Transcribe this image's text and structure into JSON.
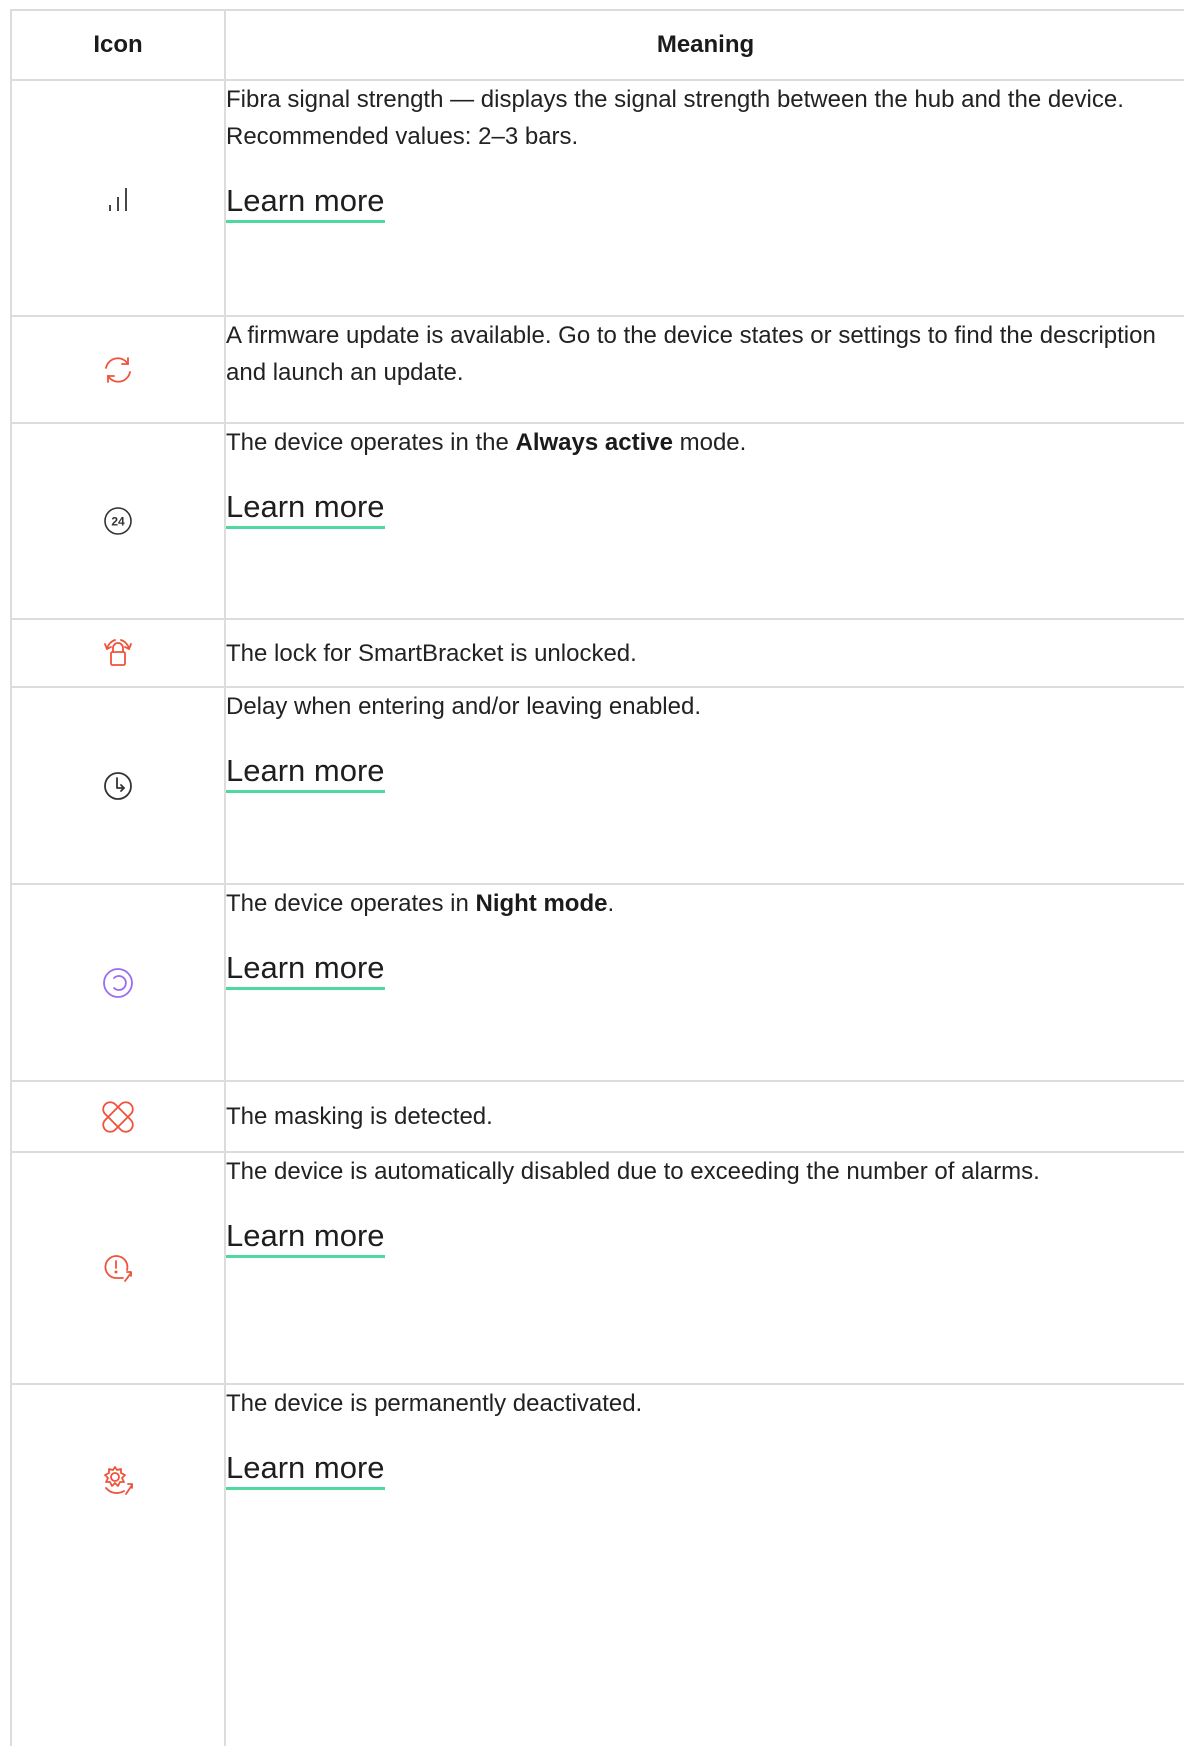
{
  "table": {
    "headers": {
      "icon": "Icon",
      "meaning": "Meaning"
    },
    "rows": [
      {
        "icon": "signal-strength-icon",
        "icon_color": "#333333",
        "text": "Fibra signal strength — displays the signal strength between the hub and the device. Recommended values: 2–3 bars.",
        "learn_more": "Learn more"
      },
      {
        "icon": "firmware-update-icon",
        "icon_color": "#f0523c",
        "text": "A firmware update is available. Go to the device states or settings to find the description and launch an update."
      },
      {
        "icon": "always-active-24-icon",
        "icon_color": "#333333",
        "text_before": "The device operates in the ",
        "text_bold": "Always active",
        "text_after": " mode.",
        "learn_more": "Learn more"
      },
      {
        "icon": "unlocked-lock-icon",
        "icon_color": "#f0523c",
        "text": "The lock for SmartBracket is unlocked."
      },
      {
        "icon": "delay-clock-icon",
        "icon_color": "#333333",
        "text": "Delay when entering and/or leaving enabled.",
        "learn_more": "Learn more"
      },
      {
        "icon": "night-mode-icon",
        "icon_color": "#9b6cf0",
        "text_before": "The device operates in ",
        "text_bold": "Night mode",
        "text_after": ".",
        "learn_more": "Learn more"
      },
      {
        "icon": "masking-detected-icon",
        "icon_color": "#f0523c",
        "text": "The masking is detected."
      },
      {
        "icon": "auto-disabled-alarms-icon",
        "icon_color": "#f0523c",
        "text": "The device is automatically disabled due to exceeding the number of alarms.",
        "learn_more": "Learn more"
      },
      {
        "icon": "permanently-deactivated-icon",
        "icon_color": "#f0523c",
        "text": "The device is permanently deactivated.",
        "learn_more": "Learn more"
      }
    ]
  },
  "icon_labels": {
    "always_active": "24"
  }
}
